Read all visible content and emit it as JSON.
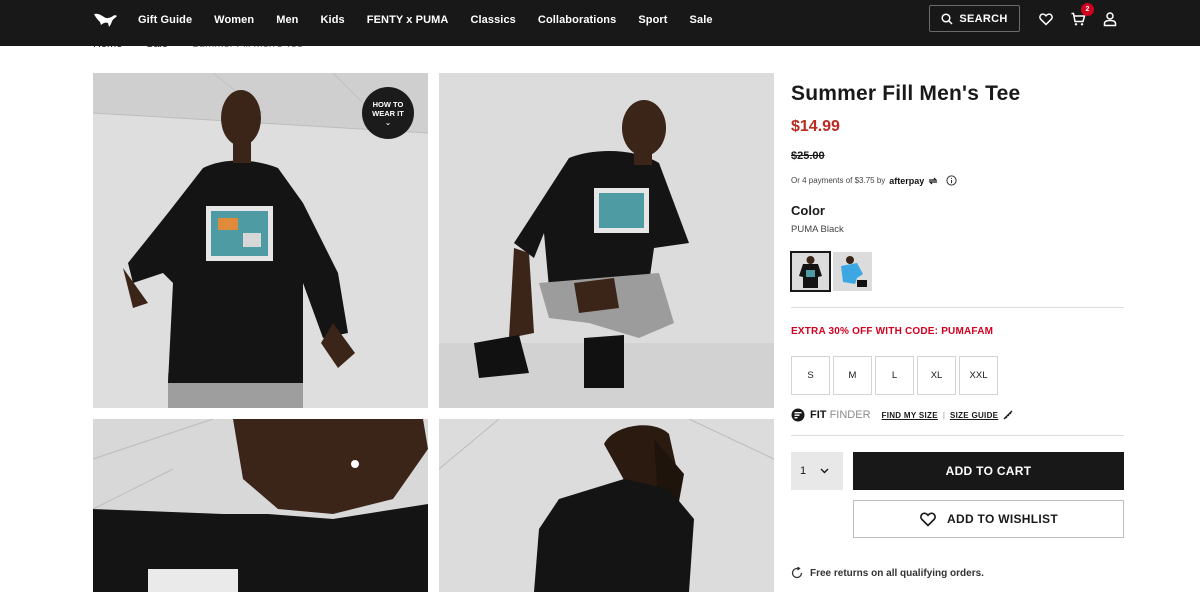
{
  "header": {
    "nav": [
      "Gift Guide",
      "Women",
      "Men",
      "Kids",
      "FENTY x PUMA",
      "Classics",
      "Collaborations",
      "Sport",
      "Sale"
    ],
    "search_label": "SEARCH",
    "cart_count": "2",
    "icons": [
      "puma-logo",
      "search-icon",
      "heart-icon",
      "cart-icon",
      "user-icon"
    ]
  },
  "breadcrumb": {
    "items": [
      "Home",
      "Sale",
      "Summer Fill Men's Tee"
    ],
    "separator": "›"
  },
  "gallery": {
    "how_to_line1": "HOW TO",
    "how_to_line2": "WEAR IT",
    "chevron": "⌄"
  },
  "product": {
    "title": "Summer Fill Men's Tee",
    "price": "$14.99",
    "old_price": "$25.00",
    "afterpay_text": "Or 4 payments of $3.75 by",
    "afterpay_brand": "afterpay",
    "color_label": "Color",
    "color_value": "PUMA Black",
    "promo": "EXTRA 30% OFF WITH CODE: PUMAFAM",
    "sizes": [
      "S",
      "M",
      "L",
      "XL",
      "XXL"
    ],
    "fit_finder_brand": "FIT",
    "fit_finder_brand2": "FINDER",
    "find_my_size": "FIND MY SIZE",
    "size_guide": "SIZE GUIDE",
    "quantity": "1",
    "add_to_cart": "ADD TO CART",
    "add_to_wishlist": "ADD TO WISHLIST",
    "returns": "Free returns on all qualifying orders.",
    "accent_red": "#d1001f",
    "price_red": "#ba2b20"
  }
}
